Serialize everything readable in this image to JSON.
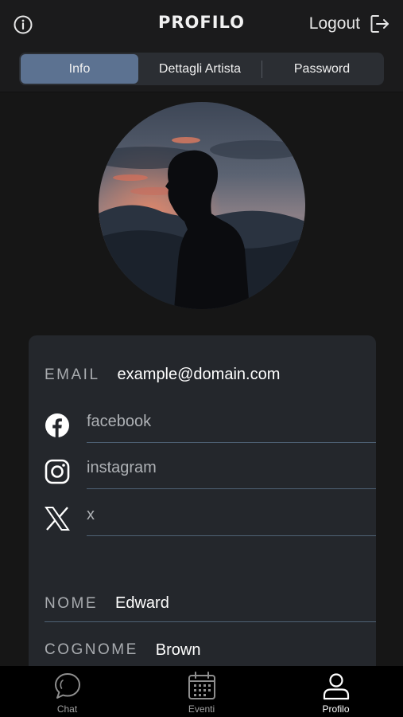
{
  "header": {
    "title": "PROFILO",
    "logout_label": "Logout"
  },
  "tabs": [
    {
      "label": "Info",
      "active": true
    },
    {
      "label": "Dettagli Artista",
      "active": false
    },
    {
      "label": "Password",
      "active": false
    }
  ],
  "profile": {
    "email_label": "EMAIL",
    "email_value": "example@domain.com",
    "social": [
      {
        "icon": "facebook-icon",
        "placeholder": "facebook"
      },
      {
        "icon": "instagram-icon",
        "placeholder": "instagram"
      },
      {
        "icon": "x-icon",
        "placeholder": "x"
      }
    ],
    "nome_label": "NOME",
    "nome_value": "Edward",
    "cognome_label": "COGNOME",
    "cognome_value": "Brown"
  },
  "bottom_nav": [
    {
      "label": "Chat",
      "icon": "chat-icon",
      "active": false
    },
    {
      "label": "Eventi",
      "icon": "calendar-icon",
      "active": false
    },
    {
      "label": "Profilo",
      "icon": "user-icon",
      "active": true
    }
  ],
  "colors": {
    "accent": "#5c7291",
    "background": "#161616",
    "card": "#24272c",
    "divider": "#4f6275"
  }
}
